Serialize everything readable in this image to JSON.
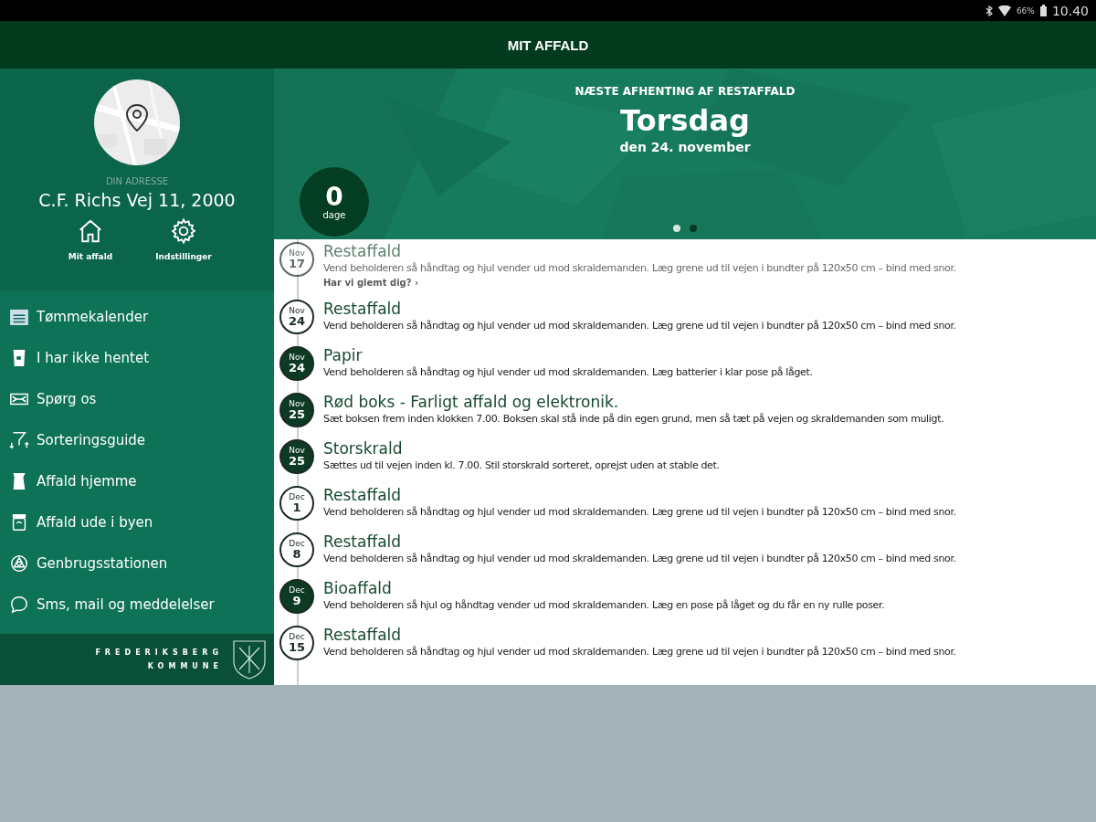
{
  "status_bar": {
    "battery": "66%",
    "time": "10.40"
  },
  "app_bar": {
    "title": "MIT AFFALD"
  },
  "profile": {
    "address_label": "DIN ADRESSE",
    "address": "C.F. Richs Vej 11, 2000",
    "actions": [
      {
        "kind": "home",
        "label": "Mit affald"
      },
      {
        "kind": "settings",
        "label": "Indstillinger"
      }
    ]
  },
  "menu": [
    {
      "kind": "calendar",
      "label": "Tømmekalender"
    },
    {
      "kind": "bin",
      "label": "I har ikke hentet"
    },
    {
      "kind": "mail",
      "label": "Spørg os"
    },
    {
      "kind": "sort",
      "label": "Sorteringsguide"
    },
    {
      "kind": "bag",
      "label": "Affald hjemme"
    },
    {
      "kind": "jar",
      "label": "Affald ude i byen"
    },
    {
      "kind": "recycle",
      "label": "Genbrugsstationen"
    },
    {
      "kind": "chat",
      "label": "Sms, mail og meddelelser"
    }
  ],
  "footer": {
    "line_1": "FREDERIKSBERG",
    "line_2": "KOMMUNE"
  },
  "hero": {
    "kicker": "NÆSTE AFHENTING AF RESTAFFALD",
    "day": "Torsdag",
    "date": "den 24. november",
    "countdown": "0",
    "countdown_unit": "dage",
    "pages": [
      {
        "selected": true
      },
      {
        "selected": false
      }
    ]
  },
  "pickups": [
    {
      "month": "Nov",
      "day": "17",
      "filled": false,
      "past": true,
      "title": "Restaffald",
      "text": "Vend beholderen så håndtag og hjul vender ud mod skraldemanden. Læg grene ud til vejen i bundter på 120x50 cm – bind med snor.",
      "link": "Har vi glemt dig? ›"
    },
    {
      "month": "Nov",
      "day": "24",
      "filled": false,
      "past": false,
      "title": "Restaffald",
      "text": "Vend beholderen så håndtag og hjul vender ud mod skraldemanden. Læg grene ud til vejen i bundter på 120x50 cm – bind med snor."
    },
    {
      "month": "Nov",
      "day": "24",
      "filled": true,
      "past": false,
      "title": "Papir",
      "text": "Vend beholderen så håndtag og hjul vender ud mod skraldemanden. Læg batterier i klar pose på låget."
    },
    {
      "month": "Nov",
      "day": "25",
      "filled": true,
      "past": false,
      "title": "Rød boks - Farligt affald og elektronik.",
      "text": "Sæt boksen frem inden klokken 7.00. Boksen skal stå inde på din egen grund, men så tæt på vejen og skraldemanden som muligt."
    },
    {
      "month": "Nov",
      "day": "25",
      "filled": true,
      "past": false,
      "title": "Storskrald",
      "text": "Sættes ud til vejen inden kl. 7.00. Stil storskrald sorteret, oprejst uden at stable det."
    },
    {
      "month": "Dec",
      "day": "1",
      "filled": false,
      "past": false,
      "title": "Restaffald",
      "text": "Vend beholderen så håndtag og hjul vender ud mod skraldemanden. Læg grene ud til vejen i bundter på 120x50 cm – bind med snor."
    },
    {
      "month": "Dec",
      "day": "8",
      "filled": false,
      "past": false,
      "title": "Restaffald",
      "text": "Vend beholderen så håndtag og hjul vender ud mod skraldemanden. Læg grene ud til vejen i bundter på 120x50 cm – bind med snor."
    },
    {
      "month": "Dec",
      "day": "9",
      "filled": true,
      "past": false,
      "title": "Bioaffald",
      "text": "Vend beholderen så hjul og håndtag vender ud mod skraldemanden. Læg en pose på låget og du får en ny rulle poser."
    },
    {
      "month": "Dec",
      "day": "15",
      "filled": false,
      "past": false,
      "title": "Restaffald",
      "text": "Vend beholderen så håndtag og hjul vender ud mod skraldemanden. Læg grene ud til vejen i bundter på 120x50 cm – bind med snor."
    }
  ]
}
